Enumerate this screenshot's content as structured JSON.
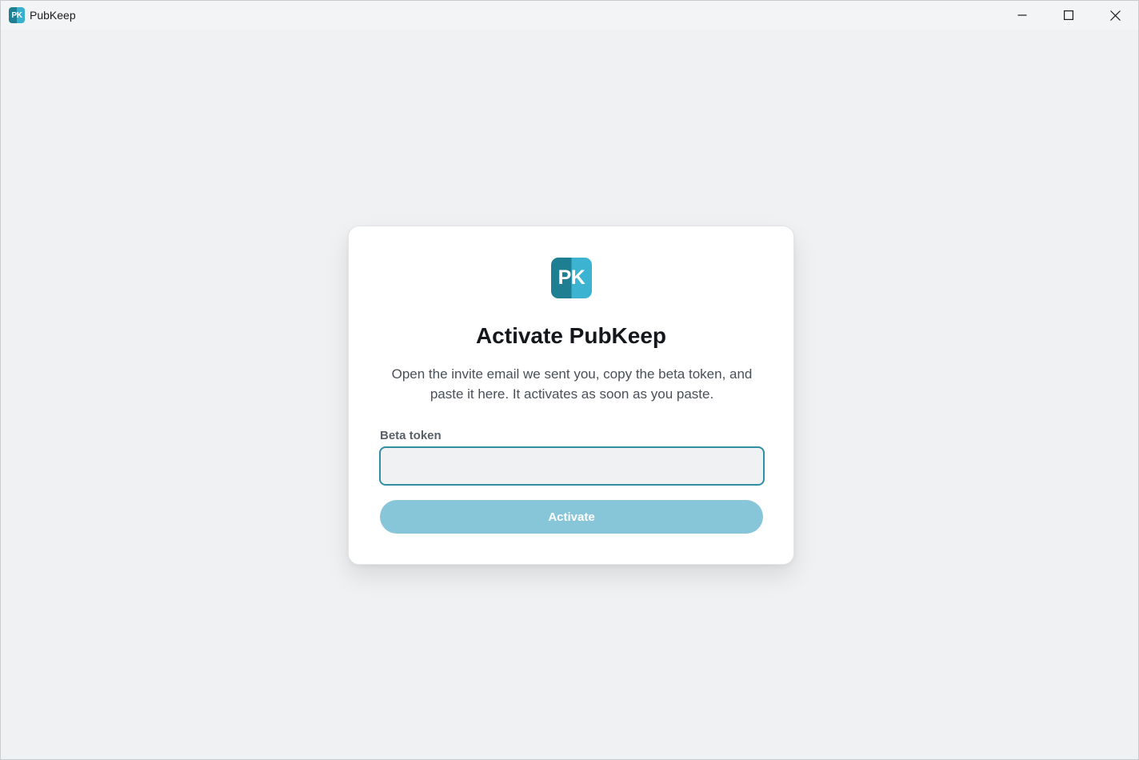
{
  "window": {
    "title": "PubKeep",
    "icon_text": "PK",
    "controls": [
      {
        "name": "minimize-icon"
      },
      {
        "name": "maximize-icon"
      },
      {
        "name": "close-icon"
      }
    ]
  },
  "card": {
    "logo_text": "PK",
    "title": "Activate PubKeep",
    "description": "Open the invite email we sent you, copy the beta token, and paste it here. It activates as soon as you paste.",
    "token_label": "Beta token",
    "token_value": "",
    "token_placeholder": "",
    "activate_label": "Activate"
  },
  "colors": {
    "accent": "#2f8fa3",
    "button_disabled": "#87c6d8",
    "logo_dark": "#1e7f93",
    "logo_light": "#3bb3d1",
    "background": "#eff1f3"
  }
}
